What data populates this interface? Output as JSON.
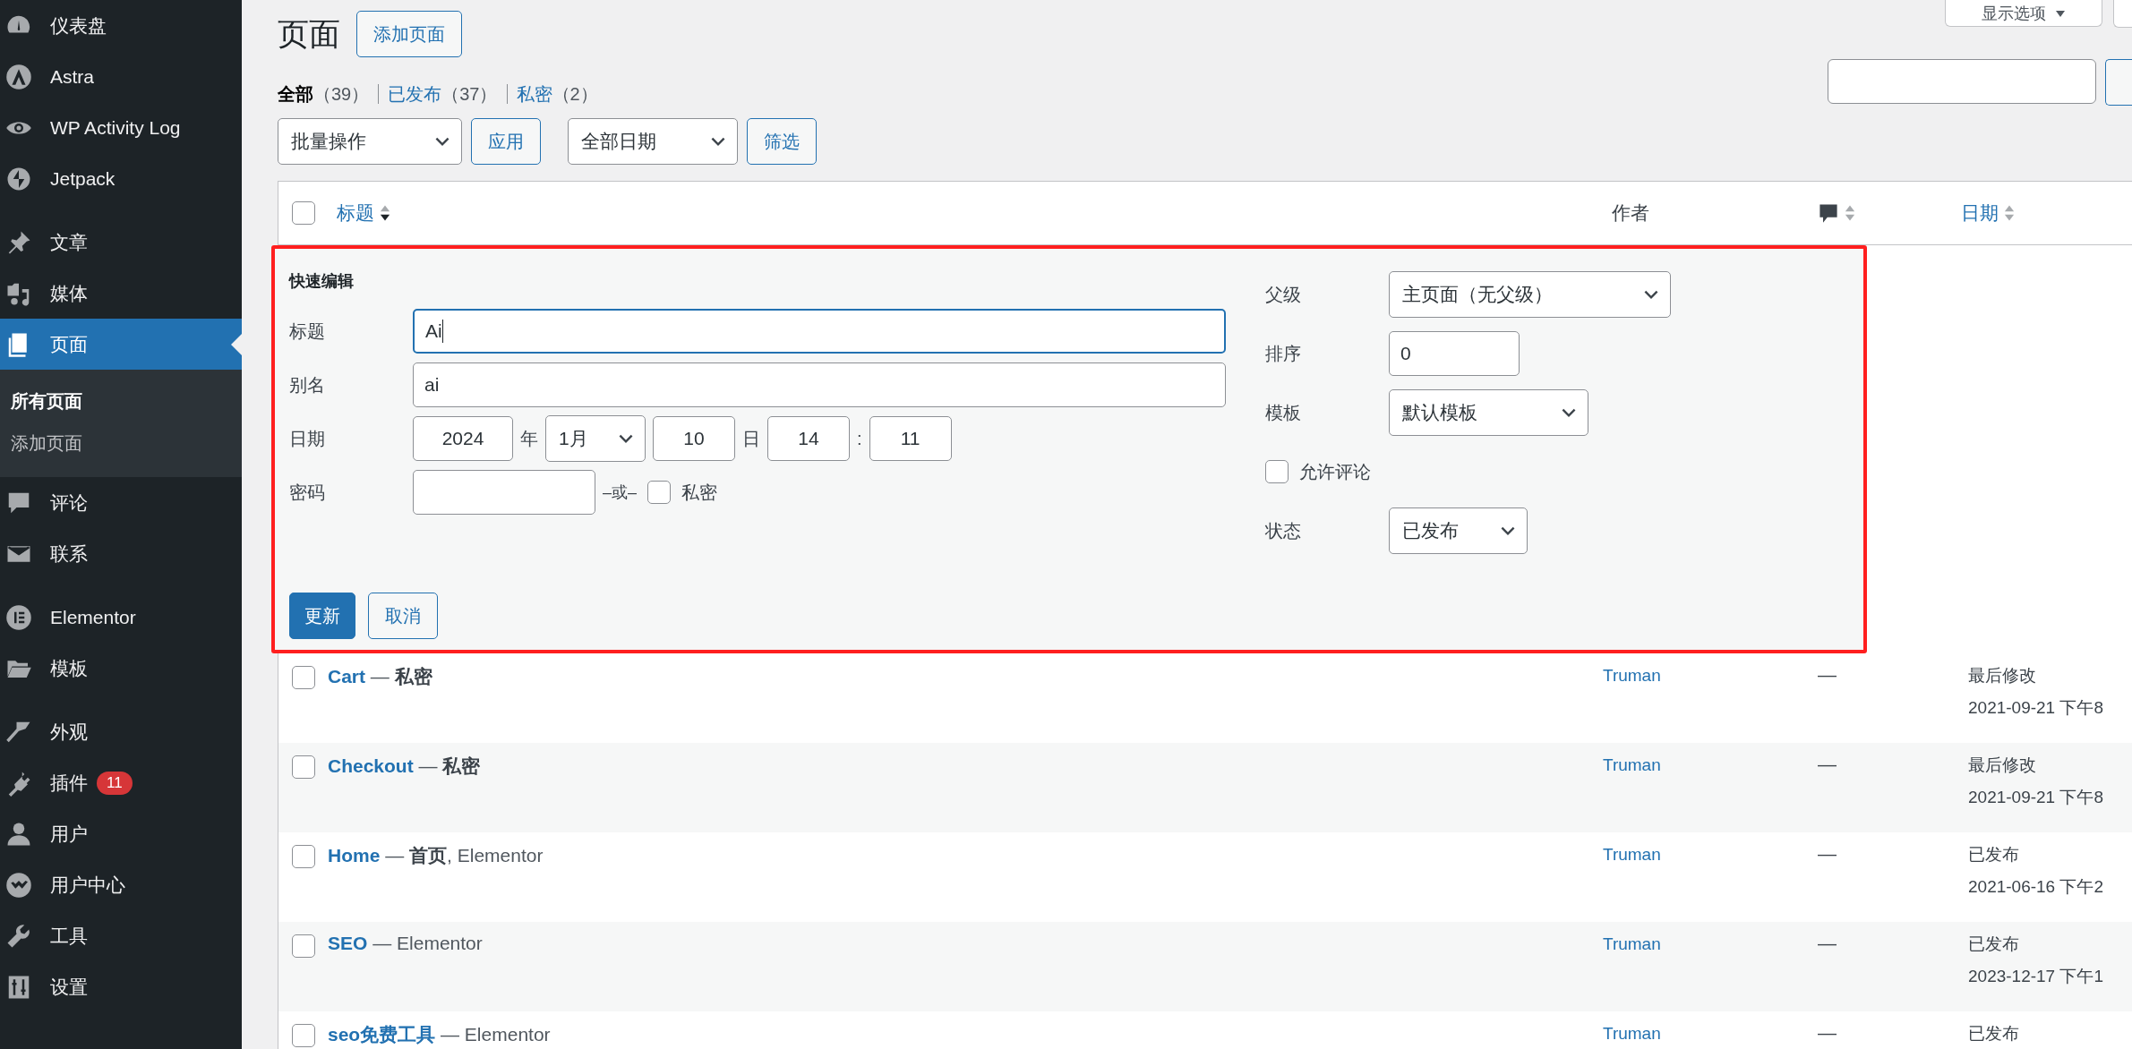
{
  "sidebar": {
    "groups": [
      {
        "items": [
          {
            "label": "仪表盘",
            "selected": false
          },
          {
            "label": "Astra",
            "selected": false
          },
          {
            "label": "WP Activity Log",
            "selected": false
          },
          {
            "label": "Jetpack",
            "selected": false
          }
        ]
      },
      {
        "items": [
          {
            "label": "文章",
            "selected": false
          },
          {
            "label": "媒体",
            "selected": false
          },
          {
            "label": "页面",
            "selected": true,
            "children": [
              {
                "label": "所有页面",
                "selected": true
              },
              {
                "label": "添加页面",
                "selected": false
              }
            ]
          },
          {
            "label": "评论",
            "selected": false
          },
          {
            "label": "联系",
            "selected": false
          }
        ]
      },
      {
        "items": [
          {
            "label": "Elementor",
            "selected": false
          },
          {
            "label": "模板",
            "selected": false
          }
        ]
      },
      {
        "items": [
          {
            "label": "外观",
            "selected": false
          },
          {
            "label": "插件",
            "selected": false,
            "badge": "11"
          },
          {
            "label": "用户",
            "selected": false
          },
          {
            "label": "用户中心",
            "selected": false
          },
          {
            "label": "工具",
            "selected": false
          },
          {
            "label": "设置",
            "selected": false
          }
        ]
      }
    ]
  },
  "screen_options": {
    "label": "显示选项"
  },
  "page_title": "页面",
  "add_button": "添加页面",
  "views": [
    {
      "label": "全部",
      "count": "（39）",
      "selected": true
    },
    {
      "label": "已发布",
      "count": "（37）",
      "selected": false
    },
    {
      "label": "私密",
      "count": "（2）",
      "selected": false
    }
  ],
  "bulk_actions": {
    "select": "批量操作",
    "apply": "应用",
    "date_select": "全部日期",
    "filter": "筛选"
  },
  "table": {
    "select_all_checked": false,
    "columns": [
      {
        "kind": "sortable",
        "label": "标题",
        "sorted": true
      },
      {
        "kind": "plain",
        "label": "作者"
      },
      {
        "kind": "comments",
        "sorted": false
      },
      {
        "kind": "sortable",
        "label": "日期",
        "sorted": false
      }
    ],
    "quick_edit": {
      "title": "快速编辑",
      "left_fields": [
        {
          "kind": "text",
          "label": "标题",
          "value": "Ai",
          "focused": true
        },
        {
          "kind": "text",
          "label": "别名",
          "value": "ai",
          "focused": false
        },
        {
          "kind": "date",
          "label": "日期",
          "year": "2024",
          "year_unit": "年",
          "month": "1月",
          "day": "10",
          "day_unit": "日",
          "hour": "14",
          "time_sep": ":",
          "minute": "11"
        },
        {
          "kind": "password",
          "label": "密码",
          "or_text": "–或–",
          "private_label": "私密",
          "private_checked": false
        }
      ],
      "right_fields": [
        {
          "kind": "select",
          "label": "父级",
          "value": "主页面（无父级）"
        },
        {
          "kind": "text",
          "label": "排序",
          "value": "0",
          "focused": false
        },
        {
          "kind": "select",
          "label": "模板",
          "value": "默认模板"
        },
        {
          "kind": "checkbox",
          "label": "允许评论",
          "checked": false
        },
        {
          "kind": "select",
          "label": "状态",
          "value": "已发布"
        }
      ],
      "buttons": [
        {
          "label": "更新",
          "primary": true
        },
        {
          "label": "取消",
          "primary": false
        }
      ]
    },
    "rows": [
      {
        "title": "Cart",
        "suffix": "— **私密**",
        "author": "Truman",
        "comments": "—",
        "date_status": "最后修改",
        "date": "2021-09-21 下午8",
        "checked": false
      },
      {
        "title": "Checkout",
        "suffix": "— **私密**",
        "author": "Truman",
        "comments": "—",
        "date_status": "最后修改",
        "date": "2021-09-21 下午8",
        "checked": false
      },
      {
        "title": "Home",
        "suffix": "— **首页**, Elementor",
        "author": "Truman",
        "comments": "—",
        "date_status": "已发布",
        "date": "2021-06-16 下午2",
        "checked": false
      },
      {
        "title": "SEO",
        "suffix": "— Elementor",
        "author": "Truman",
        "comments": "—",
        "date_status": "已发布",
        "date": "2023-12-17 下午1",
        "checked": false
      },
      {
        "title": "seo免费工具",
        "suffix": "— Elementor",
        "author": "Truman",
        "comments": "—",
        "date_status": "已发布",
        "checked": false
      }
    ]
  }
}
